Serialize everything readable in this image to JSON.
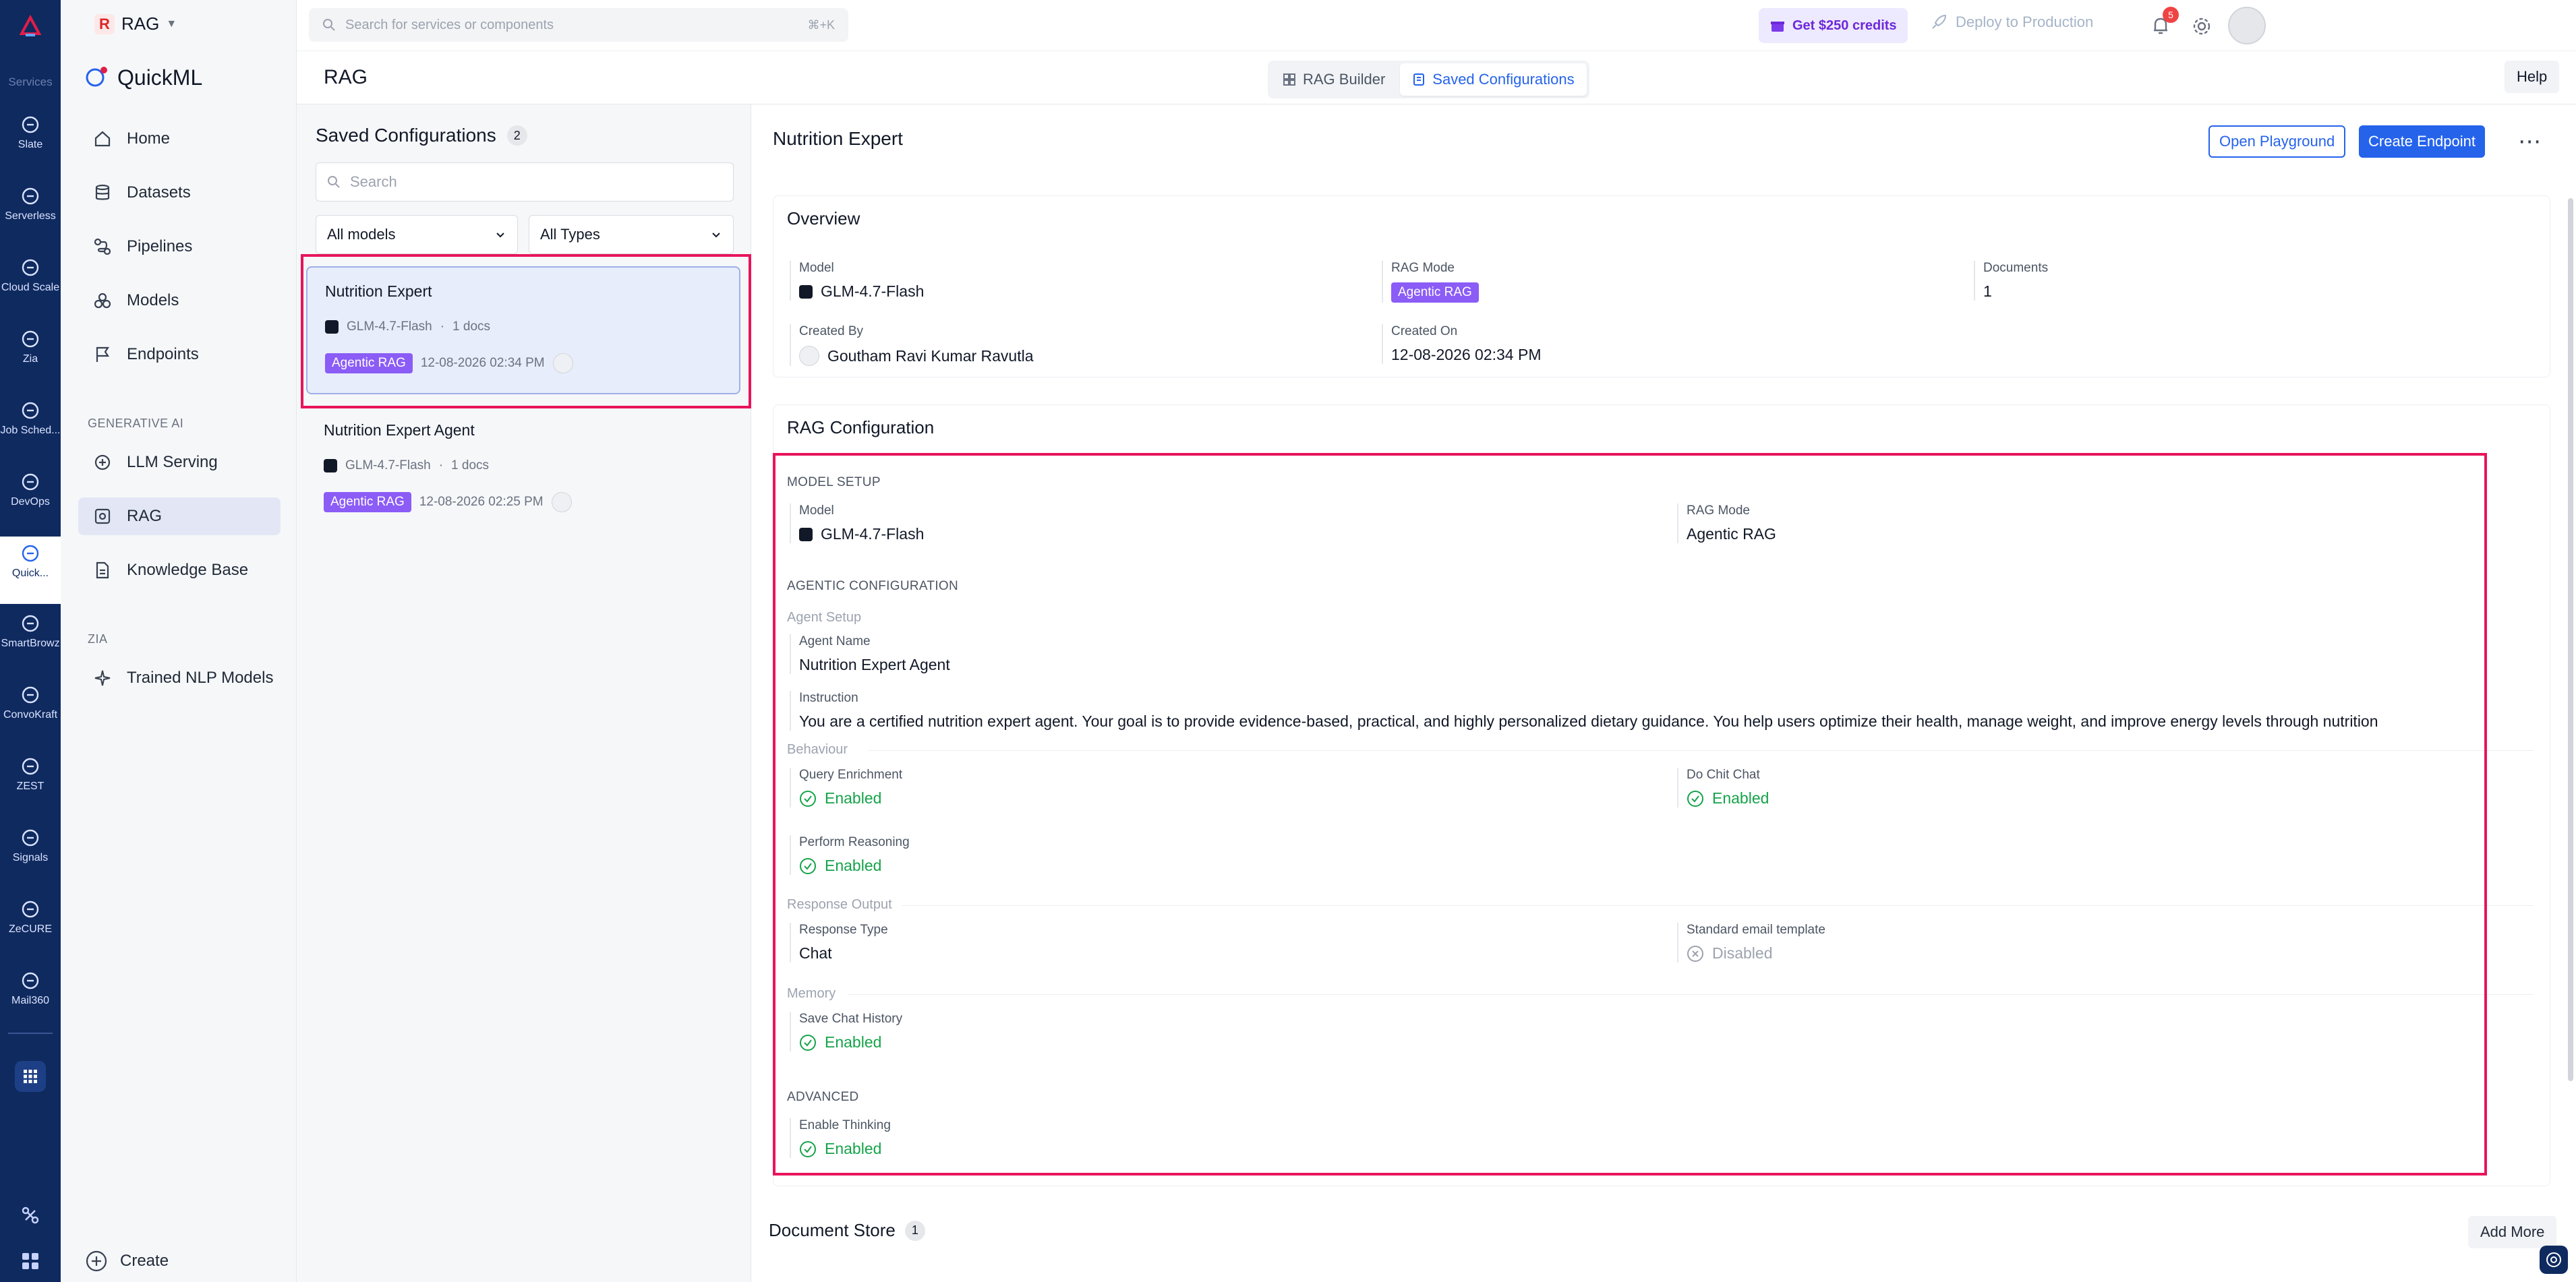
{
  "rail": {
    "section_label": "Services",
    "items": [
      {
        "label": "Slate",
        "icon": "slate-icon"
      },
      {
        "label": "Serverless",
        "icon": "serverless-icon"
      },
      {
        "label": "Cloud Scale",
        "icon": "cloud-scale-icon"
      },
      {
        "label": "Zia",
        "icon": "zia-icon"
      },
      {
        "label": "Job Sched...",
        "icon": "job-scheduling-icon"
      },
      {
        "label": "DevOps",
        "icon": "devops-icon"
      },
      {
        "label": "Quick...",
        "icon": "quickml-icon"
      },
      {
        "label": "SmartBrowz",
        "icon": "smartbrowz-icon"
      },
      {
        "label": "ConvoKraft",
        "icon": "convokraft-icon"
      },
      {
        "label": "ZEST",
        "icon": "zest-icon"
      },
      {
        "label": "Signals",
        "icon": "signals-icon"
      },
      {
        "label": "ZeCURE",
        "icon": "zecure-icon"
      },
      {
        "label": "Mail360",
        "icon": "mail360-icon"
      }
    ],
    "active_index": 6
  },
  "sidebar": {
    "project_badge": "R",
    "project_name": "RAG",
    "brand": "QuickML",
    "items": [
      {
        "label": "Home",
        "icon": "home-icon"
      },
      {
        "label": "Datasets",
        "icon": "database-icon"
      },
      {
        "label": "Pipelines",
        "icon": "pipeline-icon"
      },
      {
        "label": "Models",
        "icon": "models-icon"
      },
      {
        "label": "Endpoints",
        "icon": "flag-icon"
      }
    ],
    "group_genai": "GENERATIVE AI",
    "genai_items": [
      {
        "label": "LLM Serving",
        "icon": "llm-icon"
      },
      {
        "label": "RAG",
        "icon": "rag-icon"
      },
      {
        "label": "Knowledge Base",
        "icon": "document-icon"
      }
    ],
    "group_zia": "ZIA",
    "zia_items": [
      {
        "label": "Trained NLP Models",
        "icon": "sparkle-icon"
      }
    ],
    "create_label": "Create"
  },
  "topbar": {
    "search_placeholder": "Search for services or components",
    "search_shortcut": "⌘+K",
    "credits_label": "Get $250 credits",
    "deploy_label": "Deploy to Production",
    "notification_count": "5"
  },
  "header": {
    "title": "RAG",
    "tabs": [
      {
        "label": "RAG Builder"
      },
      {
        "label": "Saved Configurations"
      }
    ],
    "help_label": "Help"
  },
  "list": {
    "title": "Saved Configurations",
    "count": "2",
    "search_placeholder": "Search",
    "model_filter": "All models",
    "type_filter": "All Types",
    "cards": [
      {
        "name": "Nutrition Expert",
        "model": "GLM-4.7-Flash",
        "docs": "1 docs",
        "tag": "Agentic RAG",
        "date": "12-08-2026 02:34 PM"
      },
      {
        "name": "Nutrition Expert Agent",
        "model": "GLM-4.7-Flash",
        "docs": "1 docs",
        "tag": "Agentic RAG",
        "date": "12-08-2026 02:25 PM"
      }
    ],
    "separator": "·"
  },
  "detail": {
    "title": "Nutrition Expert",
    "open_playground": "Open Playground",
    "create_endpoint": "Create Endpoint",
    "more": "⋯",
    "overview": {
      "title": "Overview",
      "model_label": "Model",
      "model_value": "GLM-4.7-Flash",
      "rag_mode_label": "RAG Mode",
      "rag_mode_value": "Agentic RAG",
      "documents_label": "Documents",
      "documents_value": "1",
      "created_by_label": "Created By",
      "created_by_value": "Goutham Ravi Kumar Ravutla",
      "created_on_label": "Created On",
      "created_on_value": "12-08-2026 02:34 PM"
    },
    "rag_config": {
      "title": "RAG Configuration",
      "model_setup_caption": "MODEL SETUP",
      "model_label": "Model",
      "model_value": "GLM-4.7-Flash",
      "rag_mode_label": "RAG Mode",
      "rag_mode_value": "Agentic RAG",
      "agentic_caption": "AGENTIC CONFIGURATION",
      "agent_setup": "Agent Setup",
      "agent_name_label": "Agent Name",
      "agent_name_value": "Nutrition Expert Agent",
      "instruction_label": "Instruction",
      "instruction_value": "You are a certified nutrition expert agent. Your goal is to provide evidence-based, practical, and highly personalized dietary guidance. You help users optimize their health, manage weight, and improve energy levels through nutrition",
      "behaviour": "Behaviour",
      "query_enrichment_label": "Query Enrichment",
      "query_enrichment_value": "Enabled",
      "chit_chat_label": "Do Chit Chat",
      "chit_chat_value": "Enabled",
      "reasoning_label": "Perform Reasoning",
      "reasoning_value": "Enabled",
      "response_output": "Response Output",
      "response_type_label": "Response Type",
      "response_type_value": "Chat",
      "email_template_label": "Standard email template",
      "email_template_value": "Disabled",
      "memory": "Memory",
      "save_history_label": "Save Chat History",
      "save_history_value": "Enabled",
      "advanced_caption": "ADVANCED",
      "thinking_label": "Enable Thinking",
      "thinking_value": "Enabled"
    },
    "doc_store": {
      "title": "Document Store",
      "count": "1",
      "add_more": "Add More"
    }
  },
  "colors": {
    "rail_bg": "#0f2a5f",
    "accent": "#2563eb",
    "agentic_tag": "#8b5cf6",
    "enabled": "#16a34a",
    "highlight_box": "#e8155b"
  }
}
